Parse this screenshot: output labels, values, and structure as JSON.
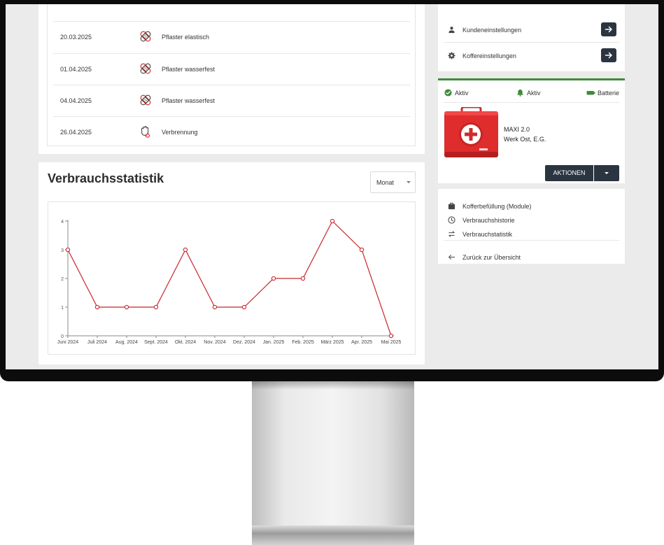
{
  "history": {
    "rows": [
      {
        "date": "20.03.2025",
        "label": "Pflaster elastisch",
        "icon": "bandage-icon"
      },
      {
        "date": "01.04.2025",
        "label": "Pflaster wasserfest",
        "icon": "bandage-icon"
      },
      {
        "date": "04.04.2025",
        "label": "Pflaster wasserfest",
        "icon": "bandage-icon"
      },
      {
        "date": "26.04.2025",
        "label": "Verbrennung",
        "icon": "burn-hand-icon"
      }
    ]
  },
  "stats": {
    "title": "Verbrauchsstatistik",
    "period_select": {
      "value": "Monat"
    }
  },
  "chart_data": {
    "type": "line",
    "title": "",
    "xlabel": "",
    "ylabel": "",
    "categories": [
      "Juni 2024",
      "Juli 2024",
      "Aug. 2024",
      "Sept. 2024",
      "Okt. 2024",
      "Nov. 2024",
      "Dez. 2024",
      "Jan. 2025",
      "Feb. 2025",
      "März 2025",
      "Apr. 2025",
      "Mai 2025"
    ],
    "values": [
      3,
      1,
      1,
      1,
      3,
      1,
      1,
      2,
      2,
      4,
      3,
      0
    ],
    "ylim": [
      0,
      4
    ],
    "yticks": [
      0,
      1,
      2,
      3,
      4
    ],
    "grid": false,
    "color": "#c8262d"
  },
  "settings": {
    "items": [
      {
        "label": "Kundeneinstellungen",
        "icon": "user-icon"
      },
      {
        "label": "Koffereinstellungen",
        "icon": "gear-icon"
      }
    ]
  },
  "status": {
    "active_label": "Aktiv",
    "alarm_label": "Aktiv",
    "battery_label": "Batterie",
    "device_name": "MAXI 2.0",
    "device_location": "Werk Ost, E.G.",
    "actions_label": "AKTIONEN",
    "accent_color": "#3f8b3b"
  },
  "nav": {
    "items": [
      {
        "label": "Kofferbefüllung (Module)",
        "icon": "briefcase-icon"
      },
      {
        "label": "Verbrauchshistorie",
        "icon": "clock-icon"
      },
      {
        "label": "Verbrauchstatistik",
        "icon": "swap-arrows-icon"
      }
    ],
    "back_label": "Zurück zur Übersicht"
  }
}
